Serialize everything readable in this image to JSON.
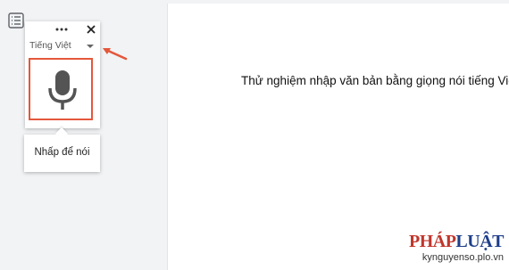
{
  "voice_panel": {
    "language": "Tiếng Việt",
    "tooltip": "Nhấp để nói"
  },
  "document": {
    "text": "Thử nghiệm nhập văn bản bằng giọng nói tiếng Việt"
  },
  "watermark": {
    "logo_part1": "PHÁP",
    "logo_part2": "LUẬT",
    "site": "kynguyenso.plo.vn"
  },
  "colors": {
    "mic_border": "#e4573b",
    "annotation_arrow": "#e4573b",
    "logo_red": "#c0362c",
    "logo_blue": "#1f3f8a"
  },
  "icons": [
    "outline-icon",
    "more-icon",
    "close-icon",
    "chevron-down-icon",
    "microphone-icon"
  ]
}
